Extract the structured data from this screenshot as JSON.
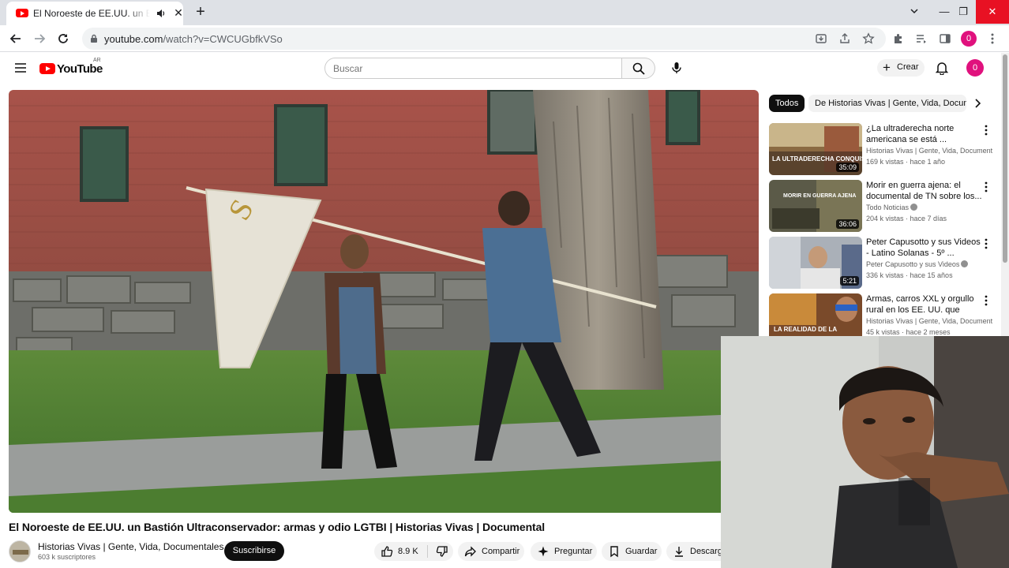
{
  "browser": {
    "tab_title": "El Noroeste de EE.UU. un Bastión Ultraconservador",
    "new_tab_label": "+",
    "url_host": "youtube.com",
    "url_path": "/watch?v=CWCUGbfkVSo",
    "profile_initial": "0"
  },
  "header": {
    "logo_text": "YouTube",
    "country_code": "AR",
    "search_placeholder": "Buscar",
    "create_label": "Crear",
    "avatar_initial": "0"
  },
  "video": {
    "title": "El Noroeste de EE.UU. un Bastión Ultraconservador: armas y odio LGTBI | Historias Vivas | Documental",
    "channel": "Historias Vivas | Gente, Vida, Documentales",
    "subscribers": "603 k suscriptores",
    "subscribe_label": "Suscribirse",
    "likes": "8.9 K",
    "share_label": "Compartir",
    "ask_label": "Preguntar",
    "save_label": "Guardar",
    "download_label": "Descargar"
  },
  "sidebar": {
    "chips": [
      "Todos",
      "De Historias Vivas | Gente, Vida, Documentales"
    ],
    "recommendations": [
      {
        "title": "¿La ultraderecha norte americana se está ...",
        "channel": "Historias Vivas | Gente, Vida, Documentales",
        "meta": "169 k vistas · hace 1 año",
        "duration": "35:09",
        "thumb_text": "LA ULTRADERECHA CONQUISTA EL OESTE",
        "verified": false
      },
      {
        "title": "Morir en guerra ajena: el documental de TN sobre los...",
        "channel": "Todo Noticias",
        "meta": "204 k vistas · hace 7 días",
        "duration": "36:06",
        "thumb_text": "MORIR EN GUERRA AJENA",
        "verified": true
      },
      {
        "title": "Peter Capusotto y sus Videos - Latino Solanas - 5º ...",
        "channel": "Peter Capusotto y sus Videos",
        "meta": "336 k vistas · hace 15 años",
        "duration": "5:21",
        "thumb_text": "",
        "verified": true
      },
      {
        "title": "Armas, carros XXL y orgullo rural en los EE. UU. que ama...",
        "channel": "Historias Vivas | Gente, Vida, Documentales",
        "meta": "45 k vistas · hace 2 meses",
        "duration": "",
        "thumb_text": "LA REALIDAD DE LA",
        "verified": false
      }
    ]
  },
  "colors": {
    "yt_red": "#ff0000",
    "avatar_pink": "#e0117d",
    "close_red": "#e81123"
  }
}
